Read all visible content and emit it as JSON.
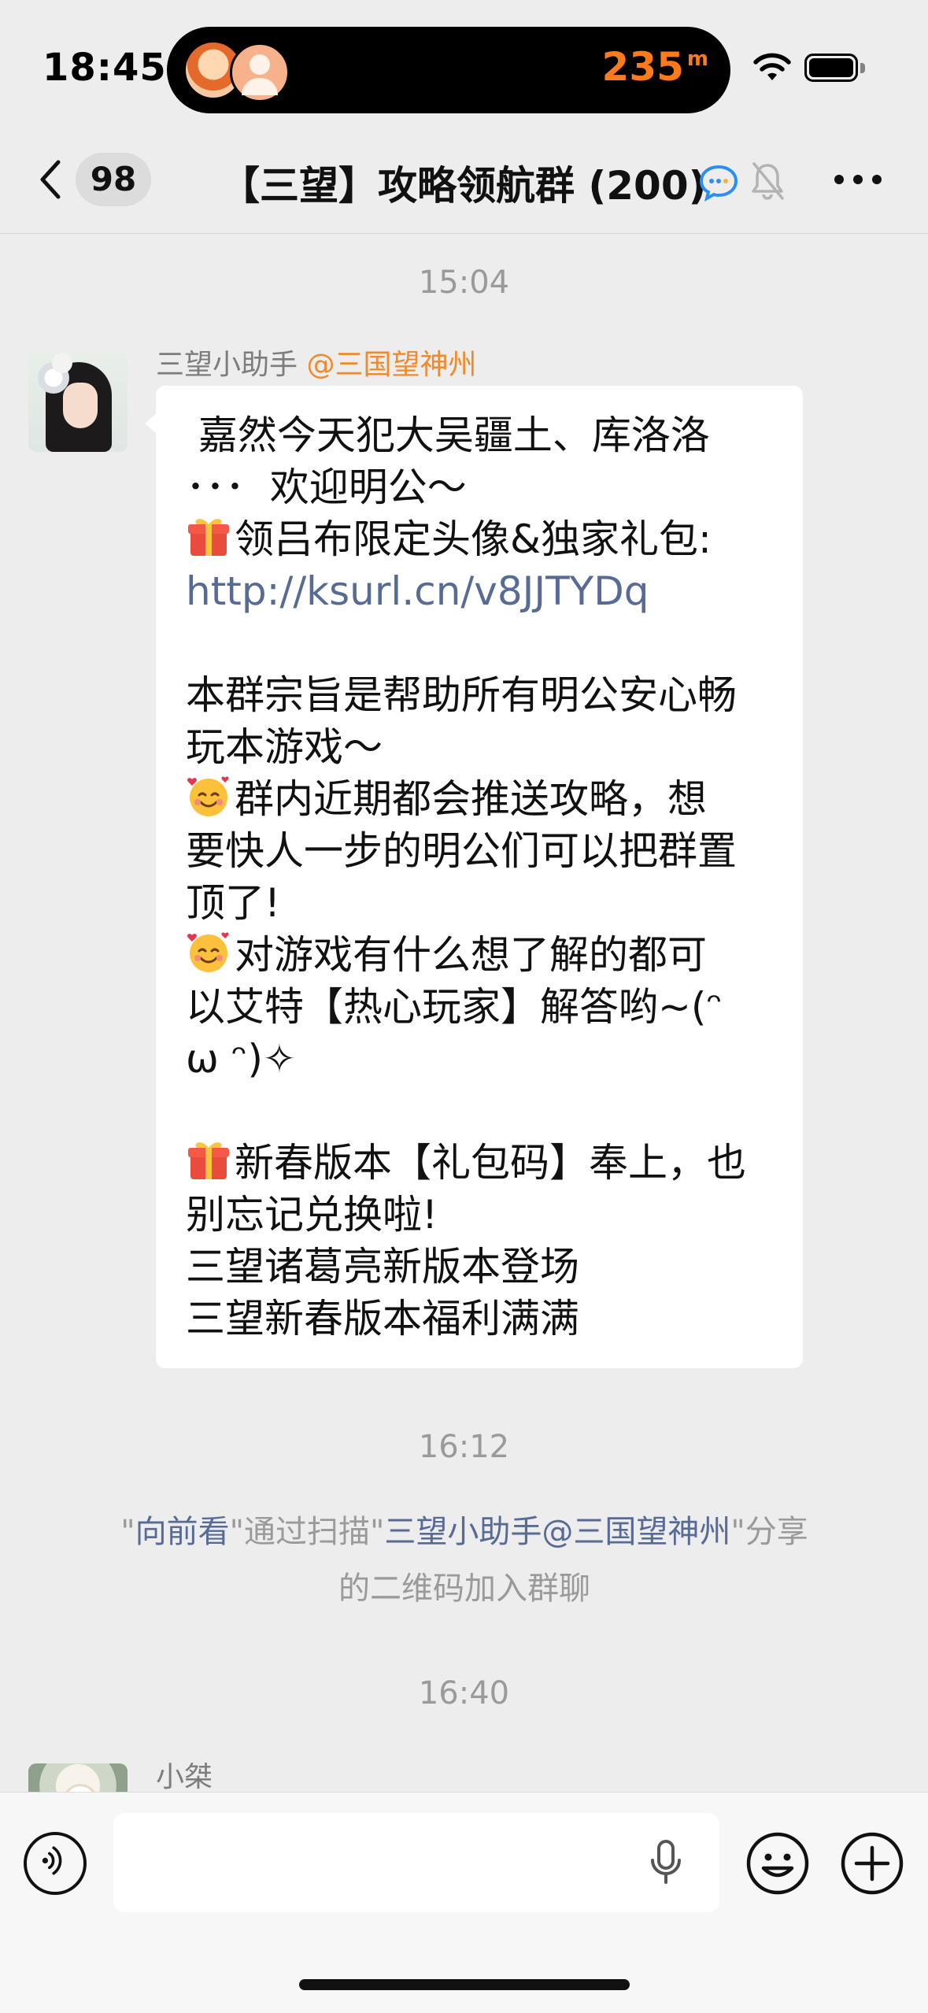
{
  "status_bar": {
    "time": "18:45",
    "activity_distance": "235",
    "activity_unit": "m"
  },
  "header": {
    "unread_count": "98",
    "title": "【三望】攻略领航群 (200)"
  },
  "messages": [
    {
      "time": "15:04",
      "sender": "三望小助手",
      "sender_tag": "@三国望神州",
      "lines": [
        {
          "emoji": "",
          "text": " 嘉然今天犯大吴疆土、库洛洛"
        },
        {
          "emoji": "",
          "text": "･･･  欢迎明公～"
        },
        {
          "emoji": "gift",
          "text": "领吕布限定头像&独家礼包:"
        },
        {
          "emoji": "",
          "text": "http://ksurl.cn/v8JJTYDq",
          "link": true
        },
        {
          "emoji": "",
          "text": ""
        },
        {
          "emoji": "",
          "text": "本群宗旨是帮助所有明公安心畅"
        },
        {
          "emoji": "",
          "text": "玩本游戏～"
        },
        {
          "emoji": "smile",
          "text": "群内近期都会推送攻略，想"
        },
        {
          "emoji": "",
          "text": "要快人一步的明公们可以把群置"
        },
        {
          "emoji": "",
          "text": "顶了!"
        },
        {
          "emoji": "smile",
          "text": "对游戏有什么想了解的都可"
        },
        {
          "emoji": "",
          "text": "以艾特【热心玩家】解答哟~(ᵔ"
        },
        {
          "emoji": "",
          "text": "ω ᵔ)✧"
        },
        {
          "emoji": "",
          "text": ""
        },
        {
          "emoji": "gift",
          "text": "新春版本【礼包码】奉上，也"
        },
        {
          "emoji": "",
          "text": "别忘记兑换啦!"
        },
        {
          "emoji": "",
          "text": "三望诸葛亮新版本登场"
        },
        {
          "emoji": "",
          "text": "三望新春版本福利满满"
        }
      ]
    }
  ],
  "system_event": {
    "time": "16:12",
    "line1_q1": "\"",
    "line1_user": "向前看",
    "line1_mid": "\"通过扫描\"",
    "line1_inviter": "三望小助手@三国望神州",
    "line1_end": "\"分享",
    "line2": "的二维码加入群聊"
  },
  "last_message": {
    "time": "16:40",
    "sender": "小桀"
  },
  "input": {
    "placeholder": ""
  }
}
